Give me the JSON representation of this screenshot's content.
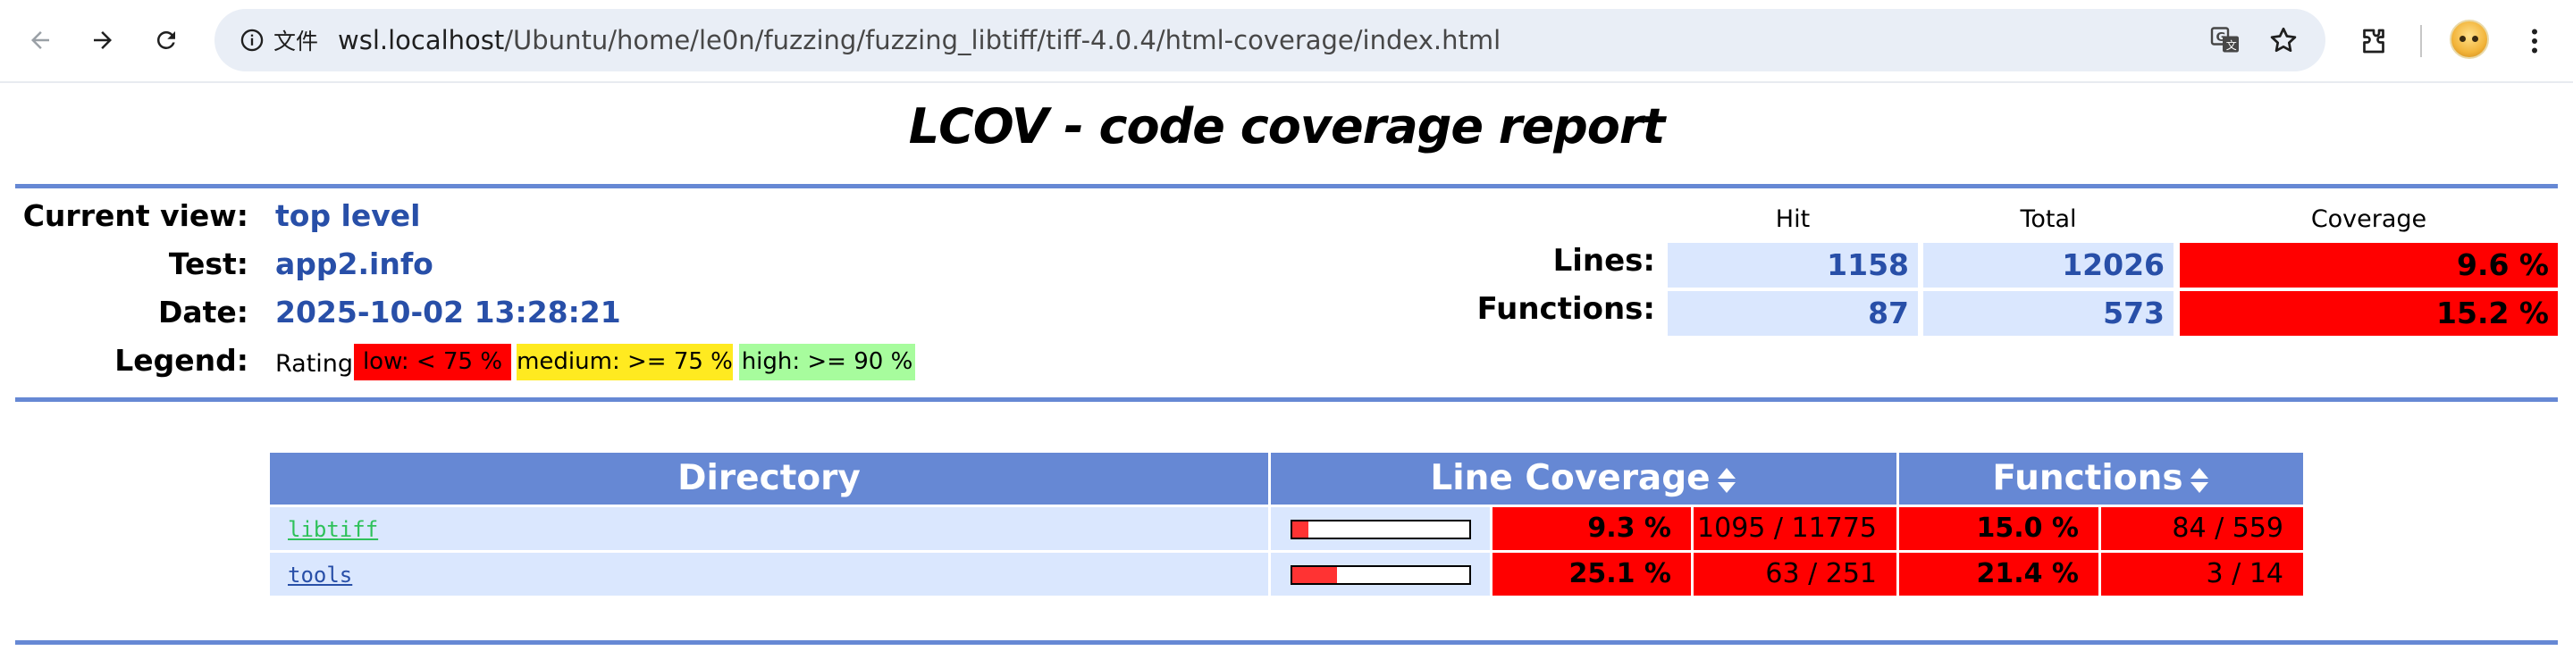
{
  "browser": {
    "site_info_label": "文件",
    "url_host": "wsl.localhost",
    "url_path": "/Ubuntu/home/le0n/fuzzing/fuzzing_libtiff/tiff-4.0.4/html-coverage/index.html"
  },
  "report": {
    "title": "LCOV - code coverage report",
    "header": {
      "current_view_label": "Current view:",
      "current_view_value": "top level",
      "test_label": "Test:",
      "test_value": "app2.info",
      "date_label": "Date:",
      "date_value": "2025-10-02 13:28:21",
      "legend_label": "Legend:",
      "rating_label": "Rating:",
      "legend_low": "low: < 75 %",
      "legend_medium": "medium: >= 75 %",
      "legend_high": "high: >= 90 %"
    },
    "summary": {
      "col_hit": "Hit",
      "col_total": "Total",
      "col_coverage": "Coverage",
      "lines_label": "Lines:",
      "lines_hit": "1158",
      "lines_total": "12026",
      "lines_coverage": "9.6 %",
      "functions_label": "Functions:",
      "functions_hit": "87",
      "functions_total": "573",
      "functions_coverage": "15.2 %"
    },
    "table": {
      "col_directory": "Directory",
      "col_line_coverage": "Line Coverage",
      "col_functions": "Functions",
      "rows": [
        {
          "name": "libtiff",
          "line_fraction": 0.093,
          "line_pct": "9.3 %",
          "line_count": "1095 / 11775",
          "func_pct": "15.0 %",
          "func_count": "84 / 559"
        },
        {
          "name": "tools",
          "line_fraction": 0.251,
          "line_pct": "25.1 %",
          "line_count": "63 / 251",
          "func_pct": "21.4 %",
          "func_count": "3 / 14"
        }
      ]
    }
  },
  "colors": {
    "low": "#ff0000",
    "medium": "#ffea20",
    "high": "#a7fc9d",
    "header_blue": "#6688d4",
    "cell_blue": "#dae7fe",
    "value_blue": "#284fa8"
  },
  "icons": [
    "back-arrow-icon",
    "forward-arrow-icon",
    "reload-icon",
    "info-icon",
    "translate-icon",
    "star-icon",
    "extensions-icon",
    "menu-dots-icon",
    "sort-icon"
  ]
}
